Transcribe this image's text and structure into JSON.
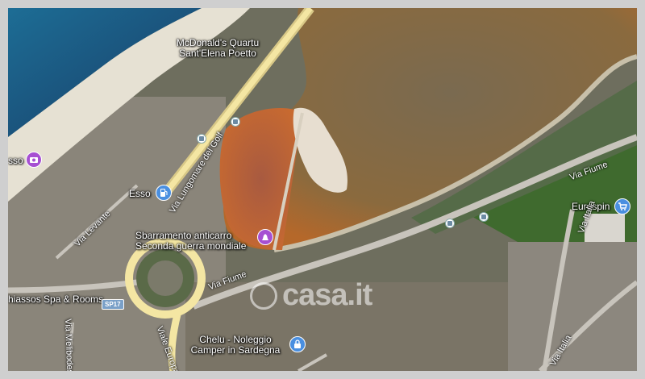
{
  "map": {
    "places": {
      "mcdonalds": "McDonald's Quartu\nSant'Elena Poetto",
      "esso_left": "sso",
      "esso": "Esso",
      "sbarramento": "Sbarramento anticarro\nSeconda guerra mondiale",
      "eurospin": "Eurospin",
      "chelu": "Chelu - Noleggio\nCamper in Sardegna",
      "spa": "hiassos Spa & Rooms"
    },
    "roads": {
      "lungomare": "Via Lungomare del Golf",
      "via_fiume_right": "Via Fiume",
      "via_fiume_bottom": "Via Fiume",
      "via_levante": "Via Levante",
      "viale_europa": "Viale Europa",
      "via_melibodes": "Via Melibodes",
      "via_italia_top": "Via Italia",
      "via_italia_bottom": "Via Italia",
      "sp17": "SP17"
    },
    "watermark": "casa.it",
    "icons": {
      "mcdonalds": "restaurant-icon",
      "esso": "gas-station-icon",
      "sbarramento": "monument-icon",
      "eurospin": "shopping-cart-icon",
      "chelu": "lock-icon",
      "esso_left": "camera-icon"
    },
    "colors": {
      "pin_purple": "#a64fd2",
      "pin_blue": "#4a8fe0",
      "lagoon": "#8a6a3c",
      "sea": "#1e5f8a"
    }
  }
}
